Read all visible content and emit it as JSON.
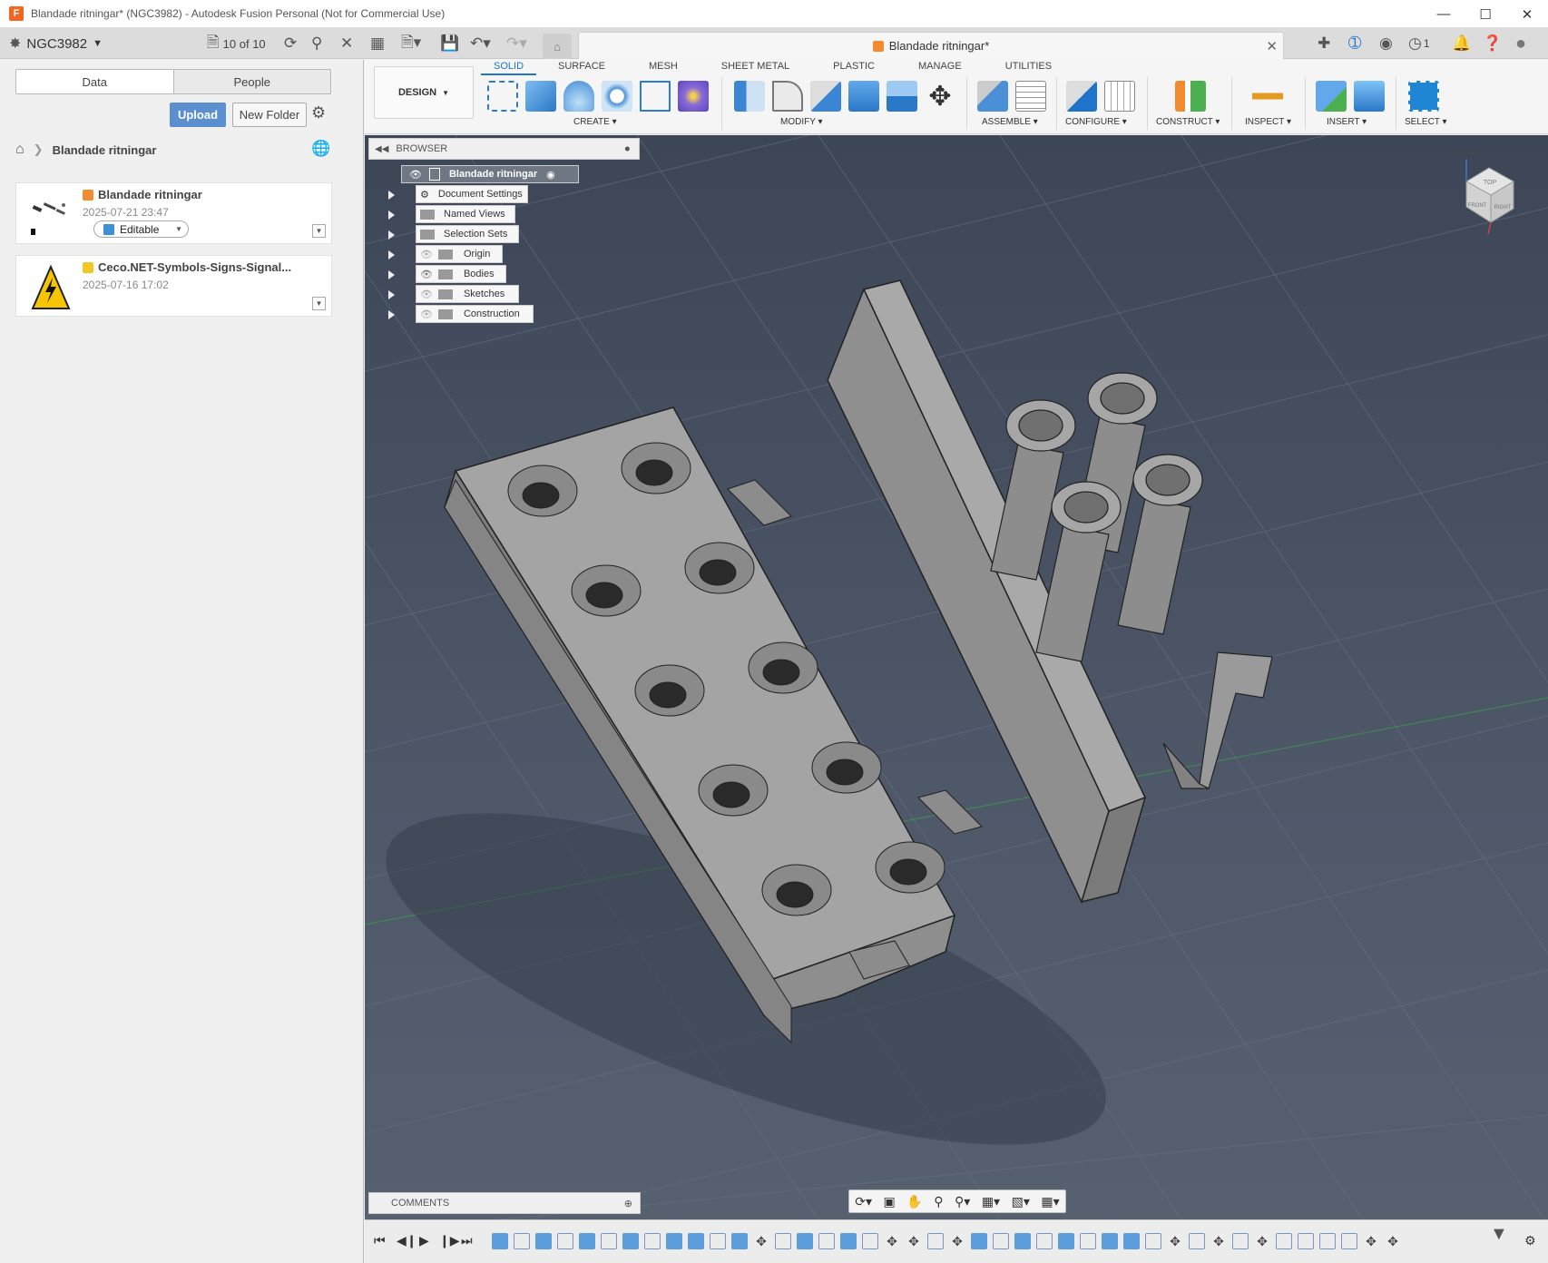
{
  "window": {
    "title": "Blandade ritningar* (NGC3982) - Autodesk Fusion Personal (Not for Commercial Use)",
    "app_icon_letter": "F"
  },
  "topbar": {
    "team": "NGC3982",
    "versions": "10 of 10",
    "doc_tab": "Blandade ritningar*",
    "notification_count": "1"
  },
  "left_panel": {
    "tabs": [
      "Data",
      "People"
    ],
    "upload_label": "Upload",
    "new_folder_label": "New Folder",
    "breadcrumb": "Blandade ritningar",
    "files": [
      {
        "name": "Blandade ritningar",
        "date": "2025-07-21 23:47",
        "status": "Editable",
        "icon_color": "#f28b2f"
      },
      {
        "name": "Ceco.NET-Symbols-Signs-Signal...",
        "date": "2025-07-16 17:02",
        "icon_color": "#f3c623"
      }
    ]
  },
  "toolbar": {
    "workspace": "DESIGN",
    "tabs": [
      "SOLID",
      "SURFACE",
      "MESH",
      "SHEET METAL",
      "PLASTIC",
      "MANAGE",
      "UTILITIES"
    ],
    "active_tab": "SOLID",
    "groups": [
      {
        "label": "CREATE"
      },
      {
        "label": "MODIFY"
      },
      {
        "label": "ASSEMBLE"
      },
      {
        "label": "CONFIGURE"
      },
      {
        "label": "CONSTRUCT"
      },
      {
        "label": "INSPECT"
      },
      {
        "label": "INSERT"
      },
      {
        "label": "SELECT"
      }
    ]
  },
  "browser": {
    "title": "BROWSER",
    "root": "Blandade ritningar",
    "items": [
      "Document Settings",
      "Named Views",
      "Selection Sets",
      "Origin",
      "Bodies",
      "Sketches",
      "Construction"
    ]
  },
  "comments": {
    "title": "COMMENTS"
  },
  "viewcube": {
    "faces": [
      "TOP",
      "FRONT",
      "RIGHT"
    ]
  },
  "colors": {
    "accent": "#1f73c8",
    "upload": "#5b8fd0",
    "viewport_top": "#3d4656",
    "viewport_bottom": "#56606f",
    "part": "#9d9d9d"
  }
}
